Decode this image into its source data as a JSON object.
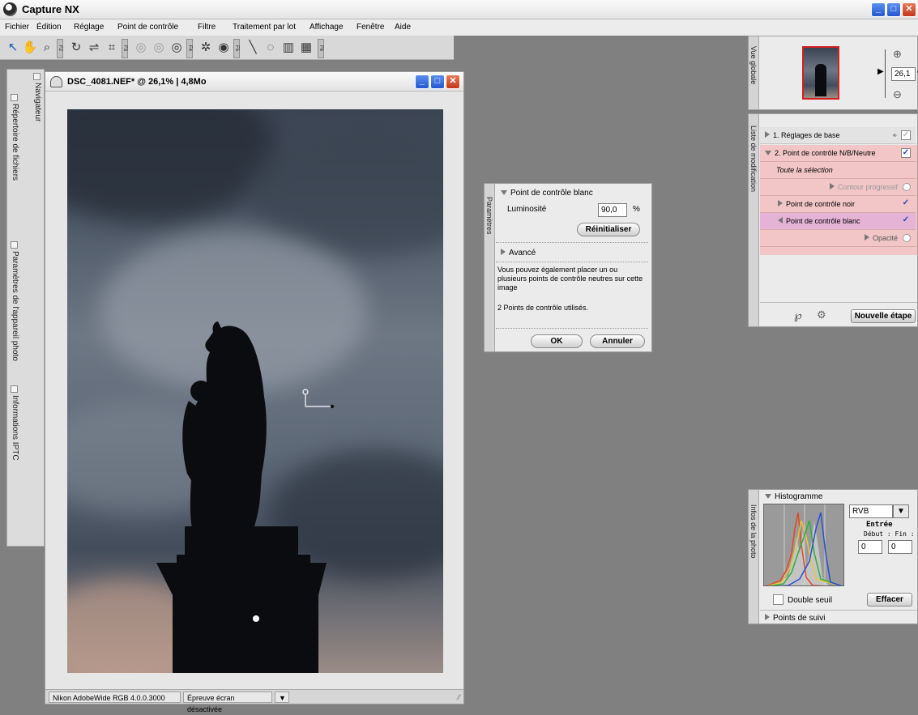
{
  "app": {
    "title": "Capture NX"
  },
  "menu": [
    "Fichier",
    "Édition",
    "Réglage",
    "Point de contrôle",
    "Filtre",
    "Traitement par lot",
    "Affichage",
    "Fenêtre",
    "Aide"
  ],
  "toolbar": {
    "fkeys": [
      "F2",
      "F3",
      "F4",
      "F5",
      "F6"
    ]
  },
  "left_dock": {
    "tabs": [
      "Navigateur",
      "Répertoire de fichiers",
      "Paramètres de l'appareil photo",
      "Informations IPTC"
    ]
  },
  "document": {
    "title": "DSC_4081.NEF* @ 26,1% | 4,8Mo",
    "status": {
      "profile": "Nikon AdobeWide RGB 4.0.0.3000",
      "proof": "Épreuve écran désactivée"
    }
  },
  "parametres": {
    "tab": "Paramètres",
    "section": "Point de contrôle blanc",
    "luminosity_label": "Luminosité",
    "luminosity_value": "90,0",
    "luminosity_unit": "%",
    "reset_label": "Réinitialiser",
    "advanced_label": "Avancé",
    "info_text": "Vous pouvez également placer un ou plusieurs points de contrôle neutres sur cette image",
    "count_text": "2 Points de contrôle utilisés.",
    "ok_label": "OK",
    "cancel_label": "Annuler"
  },
  "vue_globale": {
    "tab": "Vue globale",
    "zoom_value": "26,1",
    "zoom_unit": "%"
  },
  "modifications": {
    "tab": "Liste de modification",
    "step1": "1. Réglages de base",
    "step2": "2. Point de contrôle N/B/Neutre",
    "selection": "Toute la sélection",
    "contour": "Contour progressif",
    "noir": "Point de contrôle noir",
    "blanc": "Point de contrôle blanc",
    "opacite": "Opacité",
    "new_step_label": "Nouvelle étape"
  },
  "infos_photo": {
    "tab": "Infos de la photo",
    "title": "Histogramme",
    "channel": "RVB",
    "entry_label": "Entrée",
    "start_end_label": "Début : Fin :",
    "start_value": "0",
    "end_value": "0",
    "double_seuil_label": "Double seuil",
    "effacer_label": "Effacer",
    "points_de_suivi": "Points de suivi"
  },
  "colors": {
    "selection_bg": "#f2c6c6",
    "accent_blue": "#1a4fc0",
    "close_red": "#c1391b"
  }
}
